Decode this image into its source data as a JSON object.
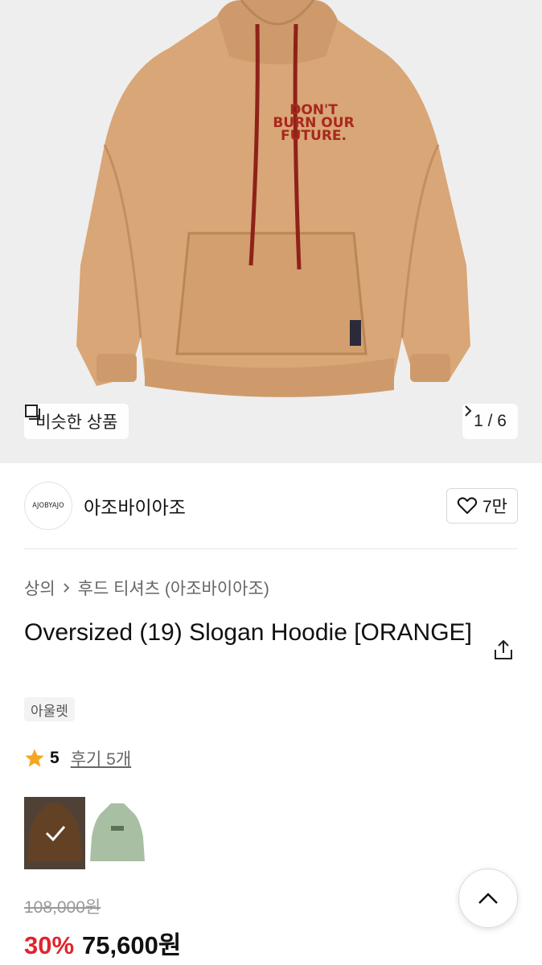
{
  "gallery": {
    "similar_label": "비슷한 상품",
    "pager": "1 / 6",
    "print_text": [
      "DON'T",
      "BURN OUR",
      "FUTURE."
    ]
  },
  "brand": {
    "logo_text": "AJOBYAJO",
    "name": "아조바이아조",
    "likes": "7만"
  },
  "breadcrumb": {
    "category": "상의",
    "subcategory": "후드 티셔츠 (아조바이아조)"
  },
  "product": {
    "title": "Oversized (19) Slogan Hoodie [ORANGE]",
    "tag": "아울렛",
    "rating": "5",
    "reviews": "후기 5개",
    "original_price": "108,000원",
    "discount": "30%",
    "sale_price": "75,600원"
  },
  "colors": {
    "hoodie": "#d9a677",
    "print": "#a8281e",
    "brown_swatch": "#8a5a34",
    "green_swatch": "#a9bfa3",
    "discount": "#e0242e",
    "star": "#f5a623"
  }
}
